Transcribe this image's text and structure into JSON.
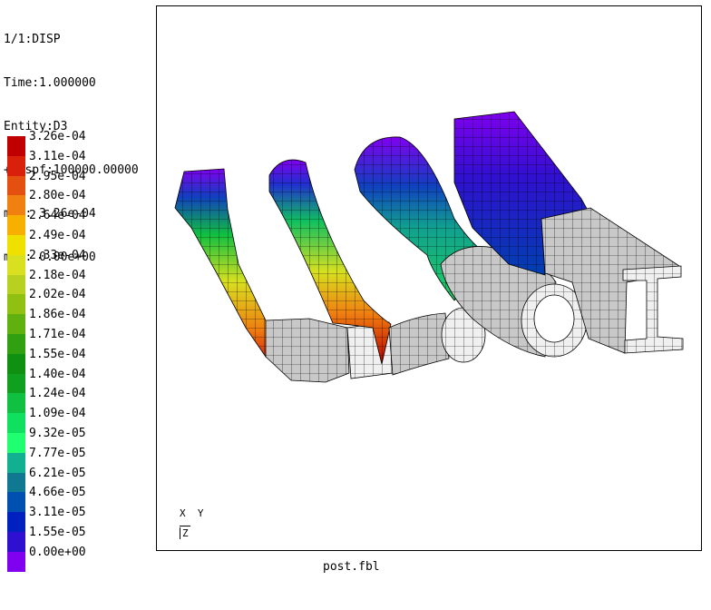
{
  "info": {
    "line1": "1/1:DISP",
    "line2": "Time:1.000000",
    "line3": "Entity:D3",
    "line4": "+Dispf:100000.00000",
    "line5": "max: 3.26e-04",
    "line6": "min: 0.00e+00"
  },
  "legend": {
    "labels": [
      "3.26e-04",
      "3.11e-04",
      "2.95e-04",
      "2.80e-04",
      "2.64e-04",
      "2.49e-04",
      "2.33e-04",
      "2.18e-04",
      "2.02e-04",
      "1.86e-04",
      "1.71e-04",
      "1.55e-04",
      "1.40e-04",
      "1.24e-04",
      "1.09e-04",
      "9.32e-05",
      "7.77e-05",
      "6.21e-05",
      "4.66e-05",
      "3.11e-05",
      "1.55e-05",
      "0.00e+00"
    ],
    "colors": [
      "#c00000",
      "#d8200a",
      "#e45010",
      "#f08010",
      "#f8b000",
      "#f0e000",
      "#d8e020",
      "#b8d020",
      "#90c010",
      "#60b010",
      "#30a010",
      "#109010",
      "#10a020",
      "#10c040",
      "#10e060",
      "#20ff70",
      "#10b090",
      "#107890",
      "#0050b0",
      "#0020c0",
      "#3010d0",
      "#8000f0"
    ]
  },
  "triad": {
    "x": "X",
    "y": "Y",
    "z": "Z"
  },
  "filename": "post.fbl"
}
